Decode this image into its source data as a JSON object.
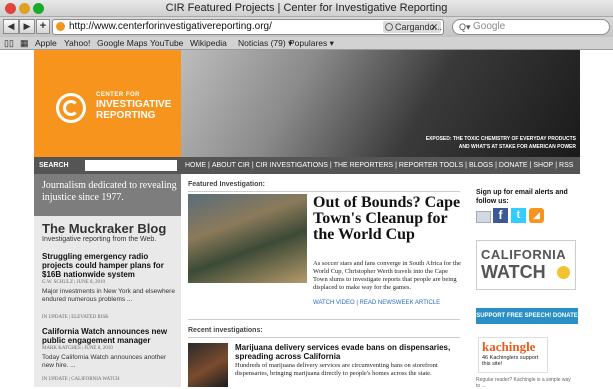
{
  "window": {
    "title": "CIR Featured Projects | Center for Investigative Reporting"
  },
  "toolbar": {
    "back": "◀",
    "forward": "▶",
    "add": "+",
    "url": "http://www.centerforinvestigativereporting.org/",
    "loading": "Cargando...",
    "search_placeholder": "Google"
  },
  "bookmarks": [
    "Apple",
    "Yahoo!",
    "Google Maps",
    "YouTube",
    "Wikipedia",
    "Noticias (79) ▾",
    "Populares ▾"
  ],
  "header": {
    "line1": "CENTER FOR",
    "line2": "INVESTIGATIVE",
    "line3": "REPORTING",
    "exposed1": "EXPOSED: THE TOXIC CHEMISTRY OF EVERYDAY PRODUCTS",
    "exposed2": "AND WHAT'S AT STAKE FOR AMERICAN POWER"
  },
  "search": {
    "label": "SEARCH"
  },
  "nav": [
    "HOME",
    "ABOUT CIR",
    "CIR INVESTIGATIONS",
    "THE REPORTERS",
    "REPORTER TOOLS",
    "BLOGS",
    "DONATE",
    "SHOP",
    "RSS"
  ],
  "sidebar": {
    "tagline": "Journalism dedicated to revealing injustice since 1977.",
    "blog_title": "The Muckraker Blog",
    "blog_sub": "Investigative reporting from the Web.",
    "posts": [
      {
        "title": "Struggling emergency radio projects could hamper plans for $16B nationwide system",
        "byline": "G.W. SCHULZ | JUNE 8, 2010",
        "excerpt": "Major investments in New York and elsewhere endured numerous problems ...",
        "meta": "IN UPDATE | ELEVATED RISK"
      },
      {
        "title": "California Watch announces new public engagement manager",
        "byline": "MARK KATCHES | JUNE 8, 2010",
        "excerpt": "Today California Watch announces another new hire. ...",
        "meta": "IN UPDATE | CALIFORNIA WATCH"
      }
    ]
  },
  "featured": {
    "label": "Featured Investigation:",
    "headline": "Out of Bounds? Cape Town's Cleanup for the World Cup",
    "body": "As soccer stars and fans converge in South Africa for the World Cup, Christopher Werth travels into the Cape Town slums to investigate reports that people are being displaced to make way for the games.",
    "links": "WATCH VIDEO | READ NEWSWEEK ARTICLE"
  },
  "recent": {
    "label": "Recent investigations:",
    "headline": "Marijuana delivery services evade bans on dispensaries, spreading across California",
    "body": "Hundreds of marijuana delivery services are circumventing bans on storefront dispensaries, bringing marijuana directly to people's homes across the state."
  },
  "right": {
    "signup": "Sign up for email alerts and follow us:",
    "cw1": "CALIFORNIA",
    "cw2": "WATCH",
    "free_speech": "SUPPORT FREE SPEECH! DONATE",
    "kachingle": "kachingle",
    "kach_count": "46 Kachinglers support this site!",
    "kach_note": "Regular reader? Kachingle is a simple way to ..."
  }
}
